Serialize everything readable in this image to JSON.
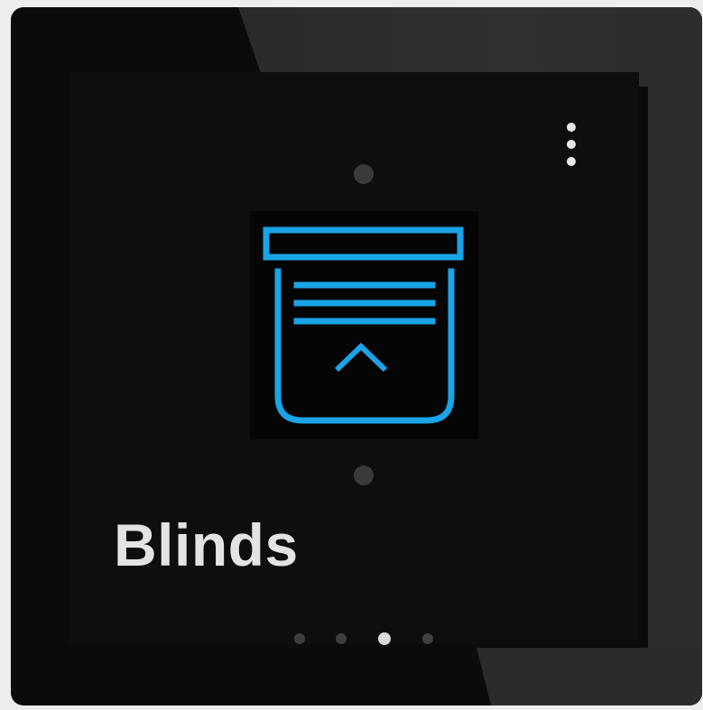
{
  "tile": {
    "title": "Blinds",
    "icon": "roller-blind-icon",
    "icon_color": "#1aa3e6",
    "background": "#0e0e0e"
  },
  "controls": {
    "menu_icon": "more-vertical-icon",
    "up_icon": "dot-up-icon",
    "down_icon": "dot-down-icon"
  },
  "pagination": {
    "total": 4,
    "active_index": 2
  }
}
